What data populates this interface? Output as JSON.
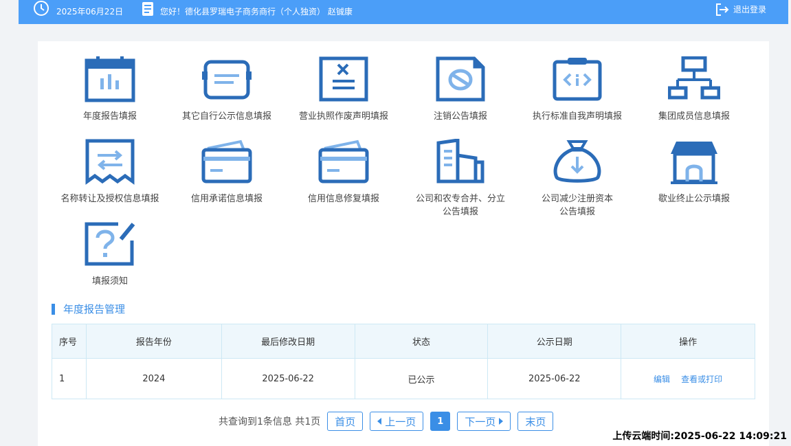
{
  "header": {
    "date": "2025年06月22日",
    "greeting": "您好！德化县罗瑞电子商务商行（个人独资） 赵铖康",
    "logout_label": "退出登录"
  },
  "tiles": [
    {
      "label": "年度报告填报",
      "icon": "calendar-chart-icon"
    },
    {
      "label": "其它自行公示信息填报",
      "icon": "message-board-icon"
    },
    {
      "label": "营业执照作废声明填报",
      "icon": "license-cancel-icon"
    },
    {
      "label": "注销公告填报",
      "icon": "forbidden-document-icon"
    },
    {
      "label": "执行标准自我声明填报",
      "icon": "clipboard-code-icon"
    },
    {
      "label": "集团成员信息填报",
      "icon": "org-tree-icon"
    },
    {
      "label": "名称转让及授权信息填报",
      "icon": "transfer-receipt-icon"
    },
    {
      "label": "信用承诺信息填报",
      "icon": "credit-card-icon"
    },
    {
      "label": "信用信息修复填报",
      "icon": "credit-card-repair-icon"
    },
    {
      "label": "公司和农专合并、分立",
      "label2": "公告填报",
      "icon": "buildings-icon"
    },
    {
      "label": "公司减少注册资本",
      "label2": "公告填报",
      "icon": "money-bag-down-icon"
    },
    {
      "label": "歇业终止公示填报",
      "icon": "store-closed-icon"
    },
    {
      "label": "填报须知",
      "icon": "question-edit-icon"
    }
  ],
  "section_title": "年度报告管理",
  "table": {
    "headers": [
      "序号",
      "报告年份",
      "最后修改日期",
      "状态",
      "公示日期",
      "操作"
    ],
    "rows": [
      {
        "index": "1",
        "year": "2024",
        "modified": "2025-06-22",
        "status": "已公示",
        "published": "2025-06-22",
        "edit": "编辑",
        "view": "查看或打印"
      }
    ]
  },
  "pager": {
    "total": "共查询到1条信息 共1页",
    "first": "首页",
    "prev": "上一页",
    "current": "1",
    "next": "下一页",
    "last": "末页"
  },
  "upload_time": "上传云端时间:2025-06-22 14:09:21",
  "colors": {
    "topbar": "#4b9ef8",
    "icon_dark": "#2b6cb8",
    "icon_light": "#7fb3ea",
    "accent": "#3a8ee6"
  }
}
